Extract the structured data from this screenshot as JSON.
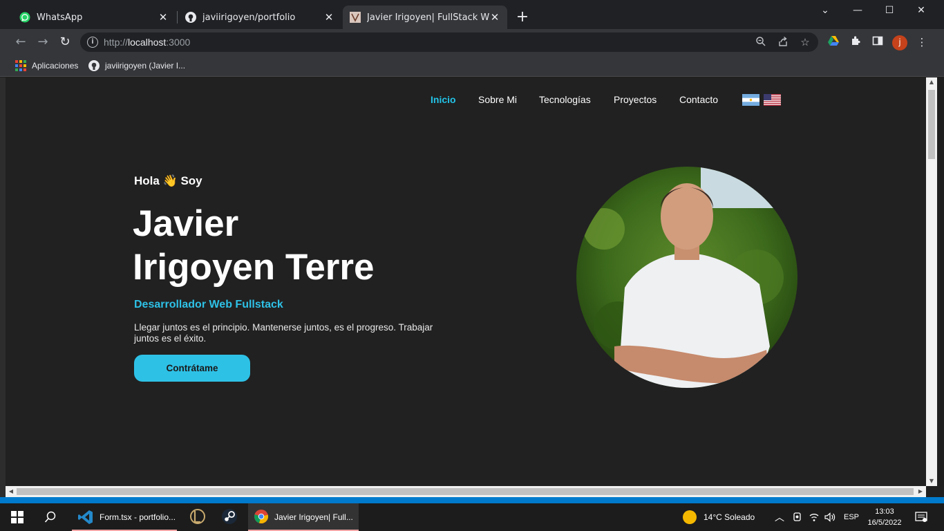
{
  "browser": {
    "tabs": [
      {
        "title": "WhatsApp",
        "icon": "whatsapp-icon"
      },
      {
        "title": "javiirigoyen/portfolio",
        "icon": "github-icon"
      },
      {
        "title": "Javier Irigoyen| FullStack Web De",
        "icon": "site-favicon"
      }
    ],
    "url_scheme": "http://",
    "url_host": "localhost",
    "url_port": ":3000",
    "bookmarks": [
      {
        "label": "Aplicaciones",
        "icon": "apps-icon"
      },
      {
        "label": "javiirigoyen (Javier I...",
        "icon": "github-icon"
      }
    ],
    "profile_initial": "j"
  },
  "page": {
    "nav": [
      "Inicio",
      "Sobre Mi",
      "Tecnologías",
      "Proyectos",
      "Contacto"
    ],
    "hello": "Hola 👋 Soy",
    "name_line1": "Javier",
    "name_line2": "Irigoyen Terre",
    "role": "Desarrollador Web Fullstack",
    "quote": "Llegar juntos es el principio. Mantenerse juntos, es el progreso. Trabajar juntos es el éxito.",
    "cta": "Contrátame",
    "accent_color": "#2ec1e6"
  },
  "taskbar": {
    "apps": [
      {
        "label": "Form.tsx - portfolio...",
        "icon": "vscode-icon"
      },
      {
        "label": "",
        "icon": "league-of-legends-icon"
      },
      {
        "label": "",
        "icon": "steam-icon"
      },
      {
        "label": "Javier Irigoyen| Full...",
        "icon": "chrome-icon"
      }
    ],
    "weather": "14°C  Soleado",
    "lang": "ESP",
    "time": "13:03",
    "date": "16/5/2022"
  }
}
